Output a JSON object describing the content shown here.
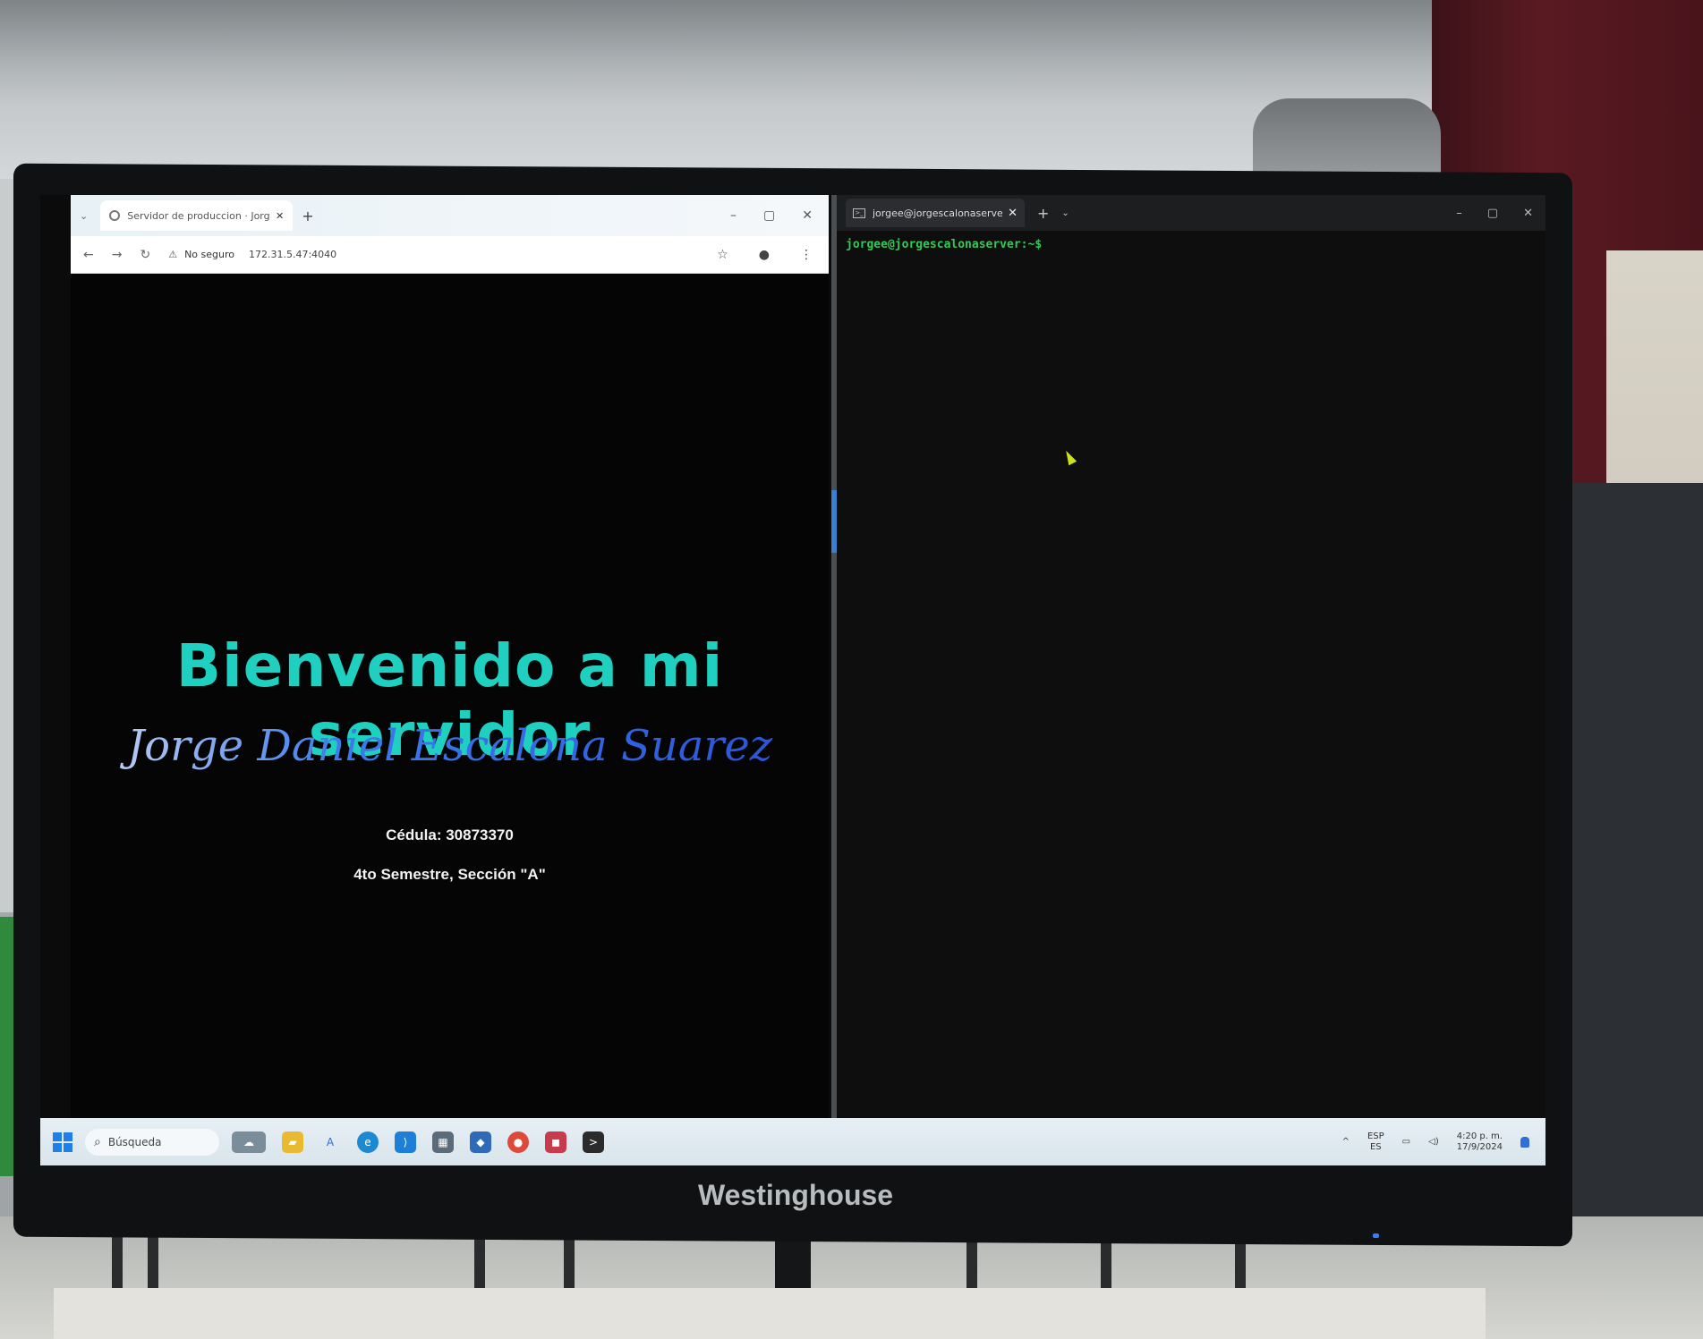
{
  "browser": {
    "tab_title": "Servidor de produccion · Jorge",
    "security_label": "No seguro",
    "url": "172.31.5.47:4040",
    "page": {
      "heading": "Bienvenido a mi servidor",
      "name": "Jorge Daniel Escalona Suarez",
      "cedula": "Cédula: 30873370",
      "semester": "4to Semestre, Sección \"A\""
    }
  },
  "terminal": {
    "tab_title": "jorgee@jorgescalonaserver: ~",
    "prompt": "jorgee@jorgescalonaserver:~$"
  },
  "taskbar": {
    "search_placeholder": "Búsqueda",
    "lang_top": "ESP",
    "lang_bottom": "ES",
    "time": "4:20 p. m.",
    "date": "17/9/2024"
  },
  "monitor": {
    "brand": "Westinghouse"
  },
  "colors": {
    "heading": "#1fd0c0",
    "prompt": "#34c957",
    "accent_blue": "#2950d8"
  }
}
